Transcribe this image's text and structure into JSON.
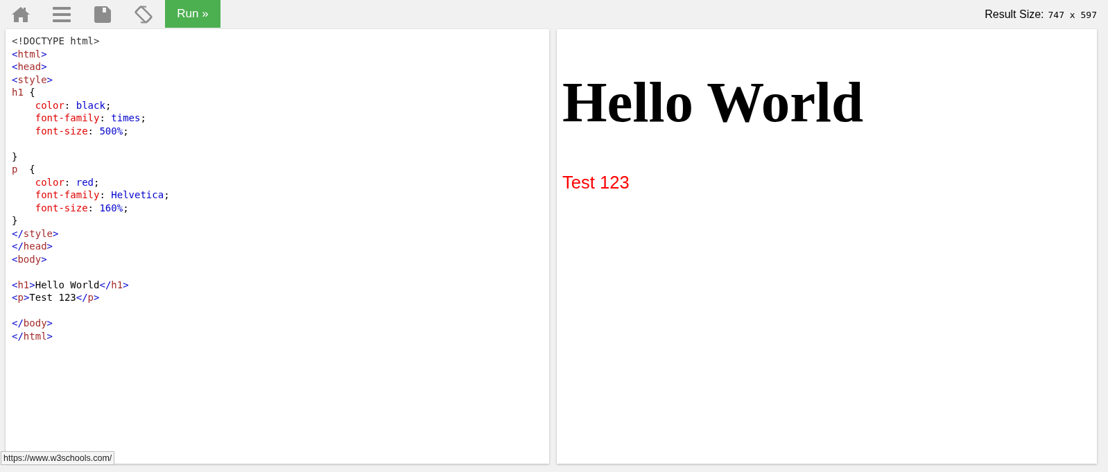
{
  "toolbar": {
    "run_button": "Run »",
    "result_size": {
      "label": "Result Size:",
      "value": "747 x 597"
    }
  },
  "code_editor": {
    "lines": [
      {
        "kind": "code",
        "tokens": [
          {
            "kind": "doctype",
            "text": "<!DOCTYPE html>"
          }
        ]
      },
      {
        "kind": "code",
        "tokens": [
          {
            "kind": "bracket",
            "text": "<"
          },
          {
            "kind": "tag",
            "text": "html"
          },
          {
            "kind": "bracket",
            "text": ">"
          }
        ]
      },
      {
        "kind": "code",
        "tokens": [
          {
            "kind": "bracket",
            "text": "<"
          },
          {
            "kind": "tag",
            "text": "head"
          },
          {
            "kind": "bracket",
            "text": ">"
          }
        ]
      },
      {
        "kind": "code",
        "tokens": [
          {
            "kind": "bracket",
            "text": "<"
          },
          {
            "kind": "tag",
            "text": "style"
          },
          {
            "kind": "bracket",
            "text": ">"
          }
        ]
      },
      {
        "kind": "code",
        "tokens": [
          {
            "kind": "tag",
            "text": "h1"
          },
          {
            "kind": "text",
            "text": " {"
          }
        ]
      },
      {
        "kind": "code",
        "tokens": [
          {
            "kind": "prop",
            "text": "    color"
          },
          {
            "kind": "text",
            "text": ": "
          },
          {
            "kind": "value",
            "text": "black"
          },
          {
            "kind": "text",
            "text": ";"
          }
        ]
      },
      {
        "kind": "code",
        "tokens": [
          {
            "kind": "prop",
            "text": "    font-family"
          },
          {
            "kind": "text",
            "text": ": "
          },
          {
            "kind": "value",
            "text": "times"
          },
          {
            "kind": "text",
            "text": ";"
          }
        ]
      },
      {
        "kind": "code",
        "tokens": [
          {
            "kind": "prop",
            "text": "    font-size"
          },
          {
            "kind": "text",
            "text": ": "
          },
          {
            "kind": "value",
            "text": "500%"
          },
          {
            "kind": "text",
            "text": ";"
          }
        ]
      },
      {
        "kind": "blank"
      },
      {
        "kind": "code",
        "tokens": [
          {
            "kind": "text",
            "text": "}"
          }
        ]
      },
      {
        "kind": "code",
        "tokens": [
          {
            "kind": "tag",
            "text": "p"
          },
          {
            "kind": "text",
            "text": "  {"
          }
        ]
      },
      {
        "kind": "code",
        "tokens": [
          {
            "kind": "prop",
            "text": "    color"
          },
          {
            "kind": "text",
            "text": ": "
          },
          {
            "kind": "value",
            "text": "red"
          },
          {
            "kind": "text",
            "text": ";"
          }
        ]
      },
      {
        "kind": "code",
        "tokens": [
          {
            "kind": "prop",
            "text": "    font-family"
          },
          {
            "kind": "text",
            "text": ": "
          },
          {
            "kind": "value",
            "text": "Helvetica"
          },
          {
            "kind": "text",
            "text": ";"
          }
        ]
      },
      {
        "kind": "code",
        "tokens": [
          {
            "kind": "prop",
            "text": "    font-size"
          },
          {
            "kind": "text",
            "text": ": "
          },
          {
            "kind": "value",
            "text": "160%"
          },
          {
            "kind": "text",
            "text": ";"
          }
        ]
      },
      {
        "kind": "code",
        "tokens": [
          {
            "kind": "text",
            "text": "}"
          }
        ]
      },
      {
        "kind": "code",
        "tokens": [
          {
            "kind": "bracket",
            "text": "</"
          },
          {
            "kind": "tag",
            "text": "style"
          },
          {
            "kind": "bracket",
            "text": ">"
          }
        ]
      },
      {
        "kind": "code",
        "tokens": [
          {
            "kind": "bracket",
            "text": "</"
          },
          {
            "kind": "tag",
            "text": "head"
          },
          {
            "kind": "bracket",
            "text": ">"
          }
        ]
      },
      {
        "kind": "code",
        "tokens": [
          {
            "kind": "bracket",
            "text": "<"
          },
          {
            "kind": "tag",
            "text": "body"
          },
          {
            "kind": "bracket",
            "text": ">"
          }
        ]
      },
      {
        "kind": "blank"
      },
      {
        "kind": "code",
        "tokens": [
          {
            "kind": "bracket",
            "text": "<"
          },
          {
            "kind": "tag",
            "text": "h1"
          },
          {
            "kind": "bracket",
            "text": ">"
          },
          {
            "kind": "text",
            "text": "Hello World"
          },
          {
            "kind": "bracket",
            "text": "</"
          },
          {
            "kind": "tag",
            "text": "h1"
          },
          {
            "kind": "bracket",
            "text": ">"
          }
        ]
      },
      {
        "kind": "code",
        "tokens": [
          {
            "kind": "bracket",
            "text": "<"
          },
          {
            "kind": "tag",
            "text": "p"
          },
          {
            "kind": "bracket",
            "text": ">"
          },
          {
            "kind": "text",
            "text": "Test 123"
          },
          {
            "kind": "bracket",
            "text": "</"
          },
          {
            "kind": "tag",
            "text": "p"
          },
          {
            "kind": "bracket",
            "text": ">"
          }
        ]
      },
      {
        "kind": "blank"
      },
      {
        "kind": "code",
        "tokens": [
          {
            "kind": "bracket",
            "text": "</"
          },
          {
            "kind": "tag",
            "text": "body"
          },
          {
            "kind": "bracket",
            "text": ">"
          }
        ]
      },
      {
        "kind": "code",
        "tokens": [
          {
            "kind": "bracket",
            "text": "</"
          },
          {
            "kind": "tag",
            "text": "html"
          },
          {
            "kind": "bracket",
            "text": ">"
          }
        ]
      }
    ]
  },
  "result": {
    "heading": "Hello World",
    "paragraph": "Test 123"
  },
  "status_link": "https://www.w3schools.com/"
}
